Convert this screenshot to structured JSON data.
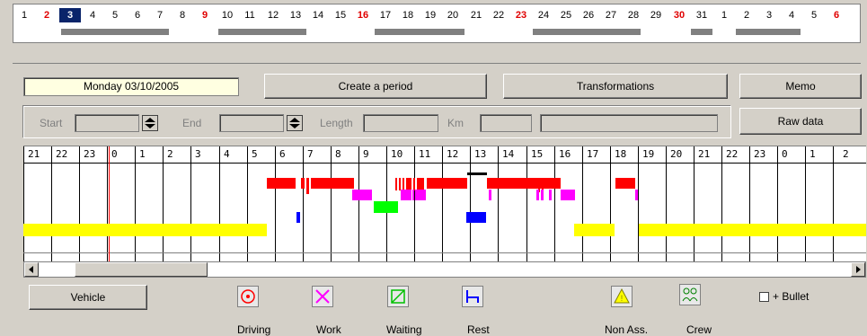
{
  "calendar": {
    "days": [
      "1",
      "2",
      "3",
      "4",
      "5",
      "6",
      "7",
      "8",
      "9",
      "10",
      "11",
      "12",
      "13",
      "14",
      "15",
      "16",
      "17",
      "18",
      "19",
      "20",
      "21",
      "22",
      "23",
      "24",
      "25",
      "26",
      "27",
      "28",
      "29",
      "30",
      "31",
      "1",
      "2",
      "3",
      "4",
      "5",
      "6"
    ],
    "red_days": [
      1,
      8,
      15,
      22,
      29,
      36
    ],
    "selected_day_index": 2
  },
  "toolbar": {
    "date": "Monday 03/10/2005",
    "create_period": "Create a period",
    "transformations": "Transformations",
    "memo": "Memo",
    "raw_data": "Raw data"
  },
  "period_fields": {
    "start": "Start",
    "end": "End",
    "length": "Length",
    "km": "Km"
  },
  "timeline": {
    "hours": [
      "21",
      "22",
      "23",
      "0",
      "1",
      "2",
      "3",
      "4",
      "5",
      "6",
      "7",
      "8",
      "9",
      "10",
      "11",
      "12",
      "13",
      "14",
      "15",
      "16",
      "17",
      "18",
      "19",
      "20",
      "21",
      "22",
      "23",
      "0",
      "1",
      "2"
    ]
  },
  "bottom": {
    "vehicle": "Vehicle",
    "bullet": "+ Bullet",
    "legend": [
      "Driving",
      "Work",
      "Waiting",
      "Rest",
      "Non Ass.",
      "Crew"
    ]
  },
  "colors": {
    "driving": "#ff0000",
    "work": "#ff00ff",
    "waiting": "#00ff00",
    "rest": "#0000ff",
    "non_assigned": "#ffff00",
    "selected": "#0a246a"
  }
}
